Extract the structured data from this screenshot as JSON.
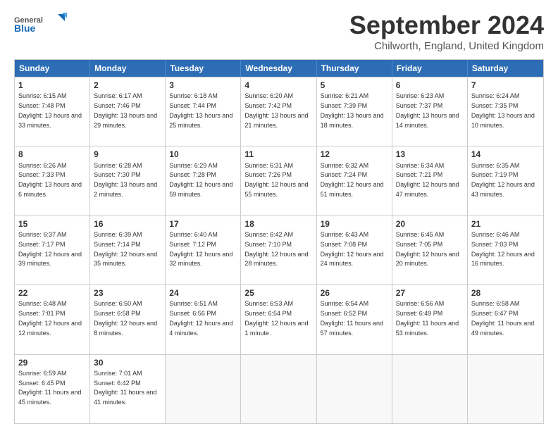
{
  "header": {
    "logo": {
      "general": "General",
      "blue": "Blue"
    },
    "title": "September 2024",
    "location": "Chilworth, England, United Kingdom"
  },
  "days": [
    "Sunday",
    "Monday",
    "Tuesday",
    "Wednesday",
    "Thursday",
    "Friday",
    "Saturday"
  ],
  "weeks": [
    [
      {
        "day": "1",
        "sunrise": "Sunrise: 6:15 AM",
        "sunset": "Sunset: 7:48 PM",
        "daylight": "Daylight: 13 hours and 33 minutes."
      },
      {
        "day": "2",
        "sunrise": "Sunrise: 6:17 AM",
        "sunset": "Sunset: 7:46 PM",
        "daylight": "Daylight: 13 hours and 29 minutes."
      },
      {
        "day": "3",
        "sunrise": "Sunrise: 6:18 AM",
        "sunset": "Sunset: 7:44 PM",
        "daylight": "Daylight: 13 hours and 25 minutes."
      },
      {
        "day": "4",
        "sunrise": "Sunrise: 6:20 AM",
        "sunset": "Sunset: 7:42 PM",
        "daylight": "Daylight: 13 hours and 21 minutes."
      },
      {
        "day": "5",
        "sunrise": "Sunrise: 6:21 AM",
        "sunset": "Sunset: 7:39 PM",
        "daylight": "Daylight: 13 hours and 18 minutes."
      },
      {
        "day": "6",
        "sunrise": "Sunrise: 6:23 AM",
        "sunset": "Sunset: 7:37 PM",
        "daylight": "Daylight: 13 hours and 14 minutes."
      },
      {
        "day": "7",
        "sunrise": "Sunrise: 6:24 AM",
        "sunset": "Sunset: 7:35 PM",
        "daylight": "Daylight: 13 hours and 10 minutes."
      }
    ],
    [
      {
        "day": "8",
        "sunrise": "Sunrise: 6:26 AM",
        "sunset": "Sunset: 7:33 PM",
        "daylight": "Daylight: 13 hours and 6 minutes."
      },
      {
        "day": "9",
        "sunrise": "Sunrise: 6:28 AM",
        "sunset": "Sunset: 7:30 PM",
        "daylight": "Daylight: 13 hours and 2 minutes."
      },
      {
        "day": "10",
        "sunrise": "Sunrise: 6:29 AM",
        "sunset": "Sunset: 7:28 PM",
        "daylight": "Daylight: 12 hours and 59 minutes."
      },
      {
        "day": "11",
        "sunrise": "Sunrise: 6:31 AM",
        "sunset": "Sunset: 7:26 PM",
        "daylight": "Daylight: 12 hours and 55 minutes."
      },
      {
        "day": "12",
        "sunrise": "Sunrise: 6:32 AM",
        "sunset": "Sunset: 7:24 PM",
        "daylight": "Daylight: 12 hours and 51 minutes."
      },
      {
        "day": "13",
        "sunrise": "Sunrise: 6:34 AM",
        "sunset": "Sunset: 7:21 PM",
        "daylight": "Daylight: 12 hours and 47 minutes."
      },
      {
        "day": "14",
        "sunrise": "Sunrise: 6:35 AM",
        "sunset": "Sunset: 7:19 PM",
        "daylight": "Daylight: 12 hours and 43 minutes."
      }
    ],
    [
      {
        "day": "15",
        "sunrise": "Sunrise: 6:37 AM",
        "sunset": "Sunset: 7:17 PM",
        "daylight": "Daylight: 12 hours and 39 minutes."
      },
      {
        "day": "16",
        "sunrise": "Sunrise: 6:39 AM",
        "sunset": "Sunset: 7:14 PM",
        "daylight": "Daylight: 12 hours and 35 minutes."
      },
      {
        "day": "17",
        "sunrise": "Sunrise: 6:40 AM",
        "sunset": "Sunset: 7:12 PM",
        "daylight": "Daylight: 12 hours and 32 minutes."
      },
      {
        "day": "18",
        "sunrise": "Sunrise: 6:42 AM",
        "sunset": "Sunset: 7:10 PM",
        "daylight": "Daylight: 12 hours and 28 minutes."
      },
      {
        "day": "19",
        "sunrise": "Sunrise: 6:43 AM",
        "sunset": "Sunset: 7:08 PM",
        "daylight": "Daylight: 12 hours and 24 minutes."
      },
      {
        "day": "20",
        "sunrise": "Sunrise: 6:45 AM",
        "sunset": "Sunset: 7:05 PM",
        "daylight": "Daylight: 12 hours and 20 minutes."
      },
      {
        "day": "21",
        "sunrise": "Sunrise: 6:46 AM",
        "sunset": "Sunset: 7:03 PM",
        "daylight": "Daylight: 12 hours and 16 minutes."
      }
    ],
    [
      {
        "day": "22",
        "sunrise": "Sunrise: 6:48 AM",
        "sunset": "Sunset: 7:01 PM",
        "daylight": "Daylight: 12 hours and 12 minutes."
      },
      {
        "day": "23",
        "sunrise": "Sunrise: 6:50 AM",
        "sunset": "Sunset: 6:58 PM",
        "daylight": "Daylight: 12 hours and 8 minutes."
      },
      {
        "day": "24",
        "sunrise": "Sunrise: 6:51 AM",
        "sunset": "Sunset: 6:56 PM",
        "daylight": "Daylight: 12 hours and 4 minutes."
      },
      {
        "day": "25",
        "sunrise": "Sunrise: 6:53 AM",
        "sunset": "Sunset: 6:54 PM",
        "daylight": "Daylight: 12 hours and 1 minute."
      },
      {
        "day": "26",
        "sunrise": "Sunrise: 6:54 AM",
        "sunset": "Sunset: 6:52 PM",
        "daylight": "Daylight: 11 hours and 57 minutes."
      },
      {
        "day": "27",
        "sunrise": "Sunrise: 6:56 AM",
        "sunset": "Sunset: 6:49 PM",
        "daylight": "Daylight: 11 hours and 53 minutes."
      },
      {
        "day": "28",
        "sunrise": "Sunrise: 6:58 AM",
        "sunset": "Sunset: 6:47 PM",
        "daylight": "Daylight: 11 hours and 49 minutes."
      }
    ],
    [
      {
        "day": "29",
        "sunrise": "Sunrise: 6:59 AM",
        "sunset": "Sunset: 6:45 PM",
        "daylight": "Daylight: 11 hours and 45 minutes."
      },
      {
        "day": "30",
        "sunrise": "Sunrise: 7:01 AM",
        "sunset": "Sunset: 6:42 PM",
        "daylight": "Daylight: 11 hours and 41 minutes."
      },
      {
        "day": "",
        "sunrise": "",
        "sunset": "",
        "daylight": ""
      },
      {
        "day": "",
        "sunrise": "",
        "sunset": "",
        "daylight": ""
      },
      {
        "day": "",
        "sunrise": "",
        "sunset": "",
        "daylight": ""
      },
      {
        "day": "",
        "sunrise": "",
        "sunset": "",
        "daylight": ""
      },
      {
        "day": "",
        "sunrise": "",
        "sunset": "",
        "daylight": ""
      }
    ]
  ]
}
